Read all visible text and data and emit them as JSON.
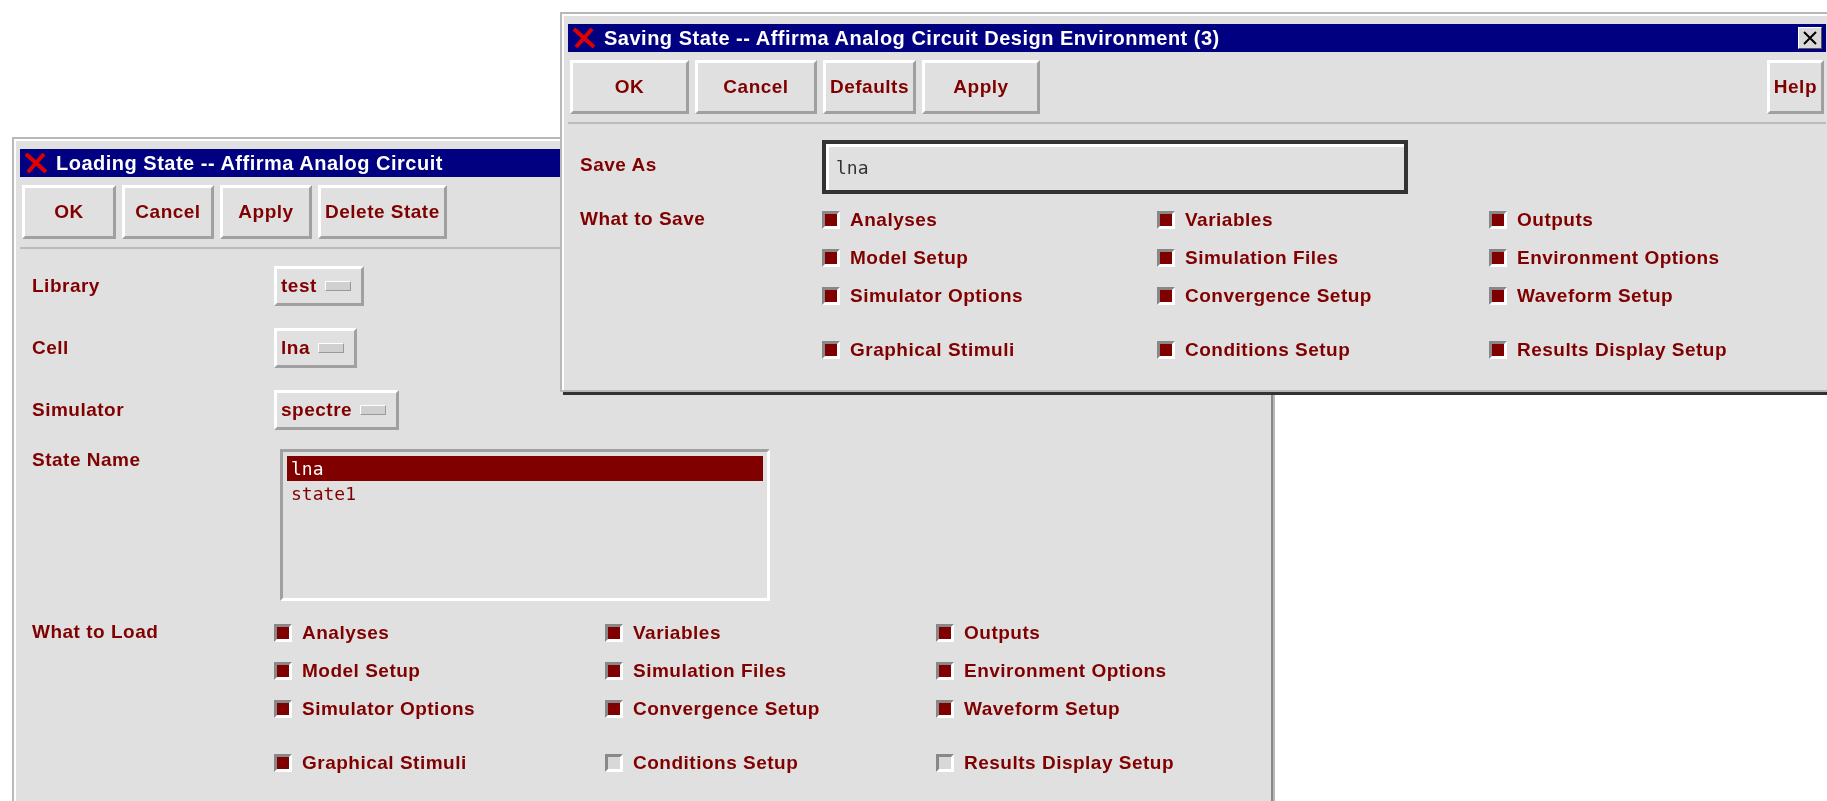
{
  "loading_window": {
    "title": "Loading State -- Affirma Analog Circuit",
    "buttons": [
      "OK",
      "Cancel",
      "Apply",
      "Delete State"
    ],
    "fields": [
      {
        "label": "Library",
        "value": "test"
      },
      {
        "label": "Cell",
        "value": "lna"
      },
      {
        "label": "Simulator",
        "value": "spectre"
      }
    ],
    "state_name": {
      "label": "State Name",
      "items": [
        {
          "text": "lna",
          "selected": true
        },
        {
          "text": "state1",
          "selected": false
        }
      ]
    },
    "what_to_load": {
      "label": "What to Load",
      "options": [
        {
          "label": "Analyses",
          "checked": true
        },
        {
          "label": "Variables",
          "checked": true
        },
        {
          "label": "Outputs",
          "checked": true
        },
        {
          "label": "Model Setup",
          "checked": true
        },
        {
          "label": "Simulation Files",
          "checked": true
        },
        {
          "label": "Environment Options",
          "checked": true
        },
        {
          "label": "Simulator Options",
          "checked": true
        },
        {
          "label": "Convergence Setup",
          "checked": true
        },
        {
          "label": "Waveform Setup",
          "checked": true
        },
        {
          "label": "Graphical Stimuli",
          "checked": true
        },
        {
          "label": "Conditions Setup",
          "checked": false
        },
        {
          "label": "Results Display Setup",
          "checked": false
        }
      ]
    }
  },
  "saving_window": {
    "title": "Saving State -- Affirma Analog Circuit Design Environment (3)",
    "buttons": [
      "OK",
      "Cancel",
      "Defaults",
      "Apply"
    ],
    "help_button": "Help",
    "save_as": {
      "label": "Save As",
      "value": "lna"
    },
    "what_to_save": {
      "label": "What to Save",
      "options": [
        {
          "label": "Analyses",
          "checked": true
        },
        {
          "label": "Variables",
          "checked": true
        },
        {
          "label": "Outputs",
          "checked": true
        },
        {
          "label": "Model Setup",
          "checked": true
        },
        {
          "label": "Simulation Files",
          "checked": true
        },
        {
          "label": "Environment Options",
          "checked": true
        },
        {
          "label": "Simulator Options",
          "checked": true
        },
        {
          "label": "Convergence Setup",
          "checked": true
        },
        {
          "label": "Waveform Setup",
          "checked": true
        },
        {
          "label": "Graphical Stimuli",
          "checked": true
        },
        {
          "label": "Conditions Setup",
          "checked": true
        },
        {
          "label": "Results Display Setup",
          "checked": true
        }
      ]
    }
  }
}
